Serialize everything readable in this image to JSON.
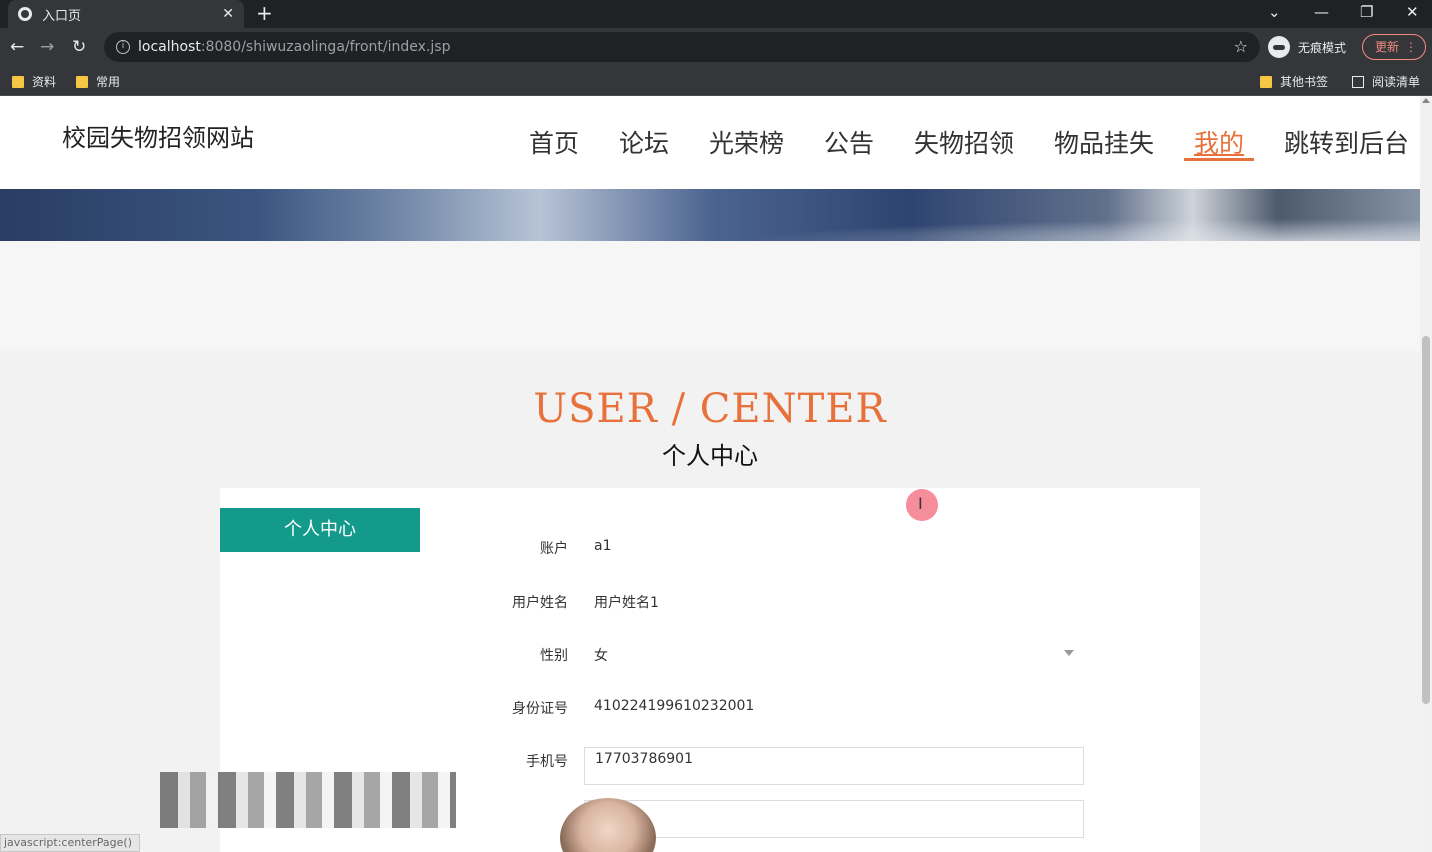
{
  "browser": {
    "tab_title": "入口页",
    "new_tab": "+",
    "url_host": "localhost",
    "url_path": ":8080/shiwuzaolinga/front/index.jsp",
    "incognito_label": "无痕模式",
    "update_label": "更新",
    "bookmarks": [
      "资料",
      "常用"
    ],
    "other_bookmarks": "其他书签",
    "reading_list": "阅读清单"
  },
  "site": {
    "title": "校园失物招领网站",
    "nav": [
      "首页",
      "论坛",
      "光荣榜",
      "公告",
      "失物招领",
      "物品挂失",
      "我的",
      "跳转到后台"
    ],
    "active_nav": "我的"
  },
  "section": {
    "title_en": "USER / CENTER",
    "title_cn": "个人中心"
  },
  "sidebar": {
    "button_label": "个人中心"
  },
  "form": {
    "account": {
      "label": "账户",
      "value": "a1"
    },
    "name": {
      "label": "用户姓名",
      "value": "用户姓名1"
    },
    "gender": {
      "label": "性别",
      "value": "女"
    },
    "id_card": {
      "label": "身份证号",
      "value": "410224199610232001"
    },
    "phone": {
      "label": "手机号",
      "value": "17703786901"
    }
  },
  "statusbar": {
    "text": "javascript:centerPage()"
  }
}
